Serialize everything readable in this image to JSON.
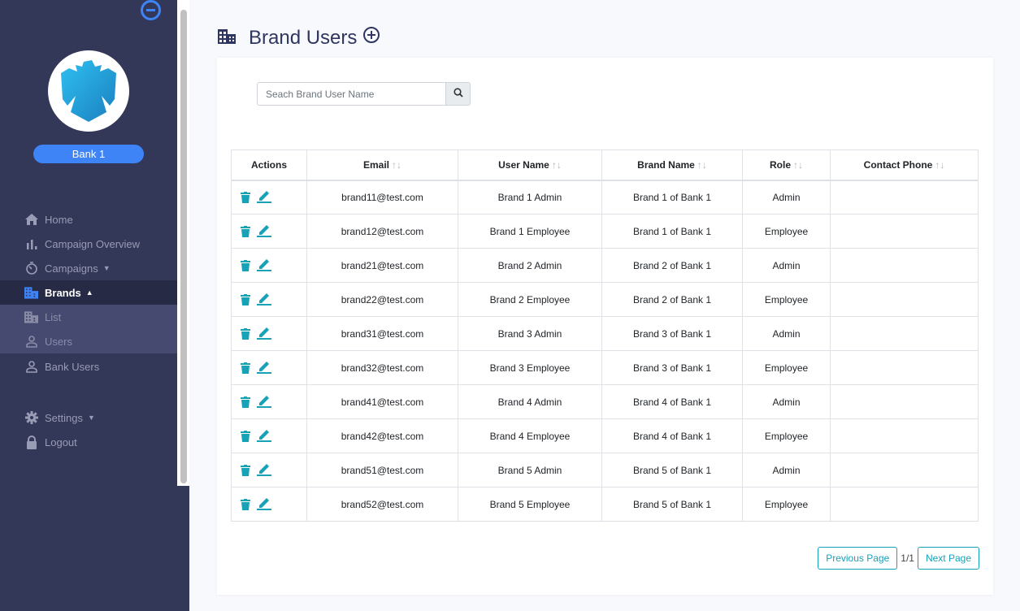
{
  "sidebar": {
    "bank_name": "Bank 1",
    "items": [
      {
        "label": "Home",
        "icon": "home-icon"
      },
      {
        "label": "Campaign Overview",
        "icon": "bar-chart-icon"
      },
      {
        "label": "Campaigns",
        "icon": "timer-icon"
      },
      {
        "label": "Brands",
        "icon": "building-icon"
      },
      {
        "label": "List",
        "icon": "building-icon"
      },
      {
        "label": "Users",
        "icon": "user-icon"
      },
      {
        "label": "Bank Users",
        "icon": "user-icon"
      },
      {
        "label": "Settings",
        "icon": "gear-icon"
      },
      {
        "label": "Logout",
        "icon": "lock-icon"
      }
    ]
  },
  "header": {
    "title": "Brand Users"
  },
  "search": {
    "placeholder": "Seach Brand User Name"
  },
  "table": {
    "columns": [
      "Actions",
      "Email",
      "User Name",
      "Brand Name",
      "Role",
      "Contact Phone"
    ],
    "rows": [
      [
        "brand11@test.com",
        "Brand 1 Admin",
        "Brand 1 of Bank 1",
        "Admin",
        ""
      ],
      [
        "brand12@test.com",
        "Brand 1 Employee",
        "Brand 1 of Bank 1",
        "Employee",
        ""
      ],
      [
        "brand21@test.com",
        "Brand 2 Admin",
        "Brand 2 of Bank 1",
        "Admin",
        ""
      ],
      [
        "brand22@test.com",
        "Brand 2 Employee",
        "Brand 2 of Bank 1",
        "Employee",
        ""
      ],
      [
        "brand31@test.com",
        "Brand 3 Admin",
        "Brand 3 of Bank 1",
        "Admin",
        ""
      ],
      [
        "brand32@test.com",
        "Brand 3 Employee",
        "Brand 3 of Bank 1",
        "Employee",
        ""
      ],
      [
        "brand41@test.com",
        "Brand 4 Admin",
        "Brand 4 of Bank 1",
        "Admin",
        ""
      ],
      [
        "brand42@test.com",
        "Brand 4 Employee",
        "Brand 4 of Bank 1",
        "Employee",
        ""
      ],
      [
        "brand51@test.com",
        "Brand 5 Admin",
        "Brand 5 of Bank 1",
        "Admin",
        ""
      ],
      [
        "brand52@test.com",
        "Brand 5 Employee",
        "Brand 5 of Bank 1",
        "Employee",
        ""
      ]
    ]
  },
  "pager": {
    "prev": "Previous Page",
    "page": "1/1",
    "next": "Next Page"
  },
  "colors": {
    "accent": "#3e84f7",
    "teal": "#17a2b8",
    "sidebar": "#333758"
  }
}
